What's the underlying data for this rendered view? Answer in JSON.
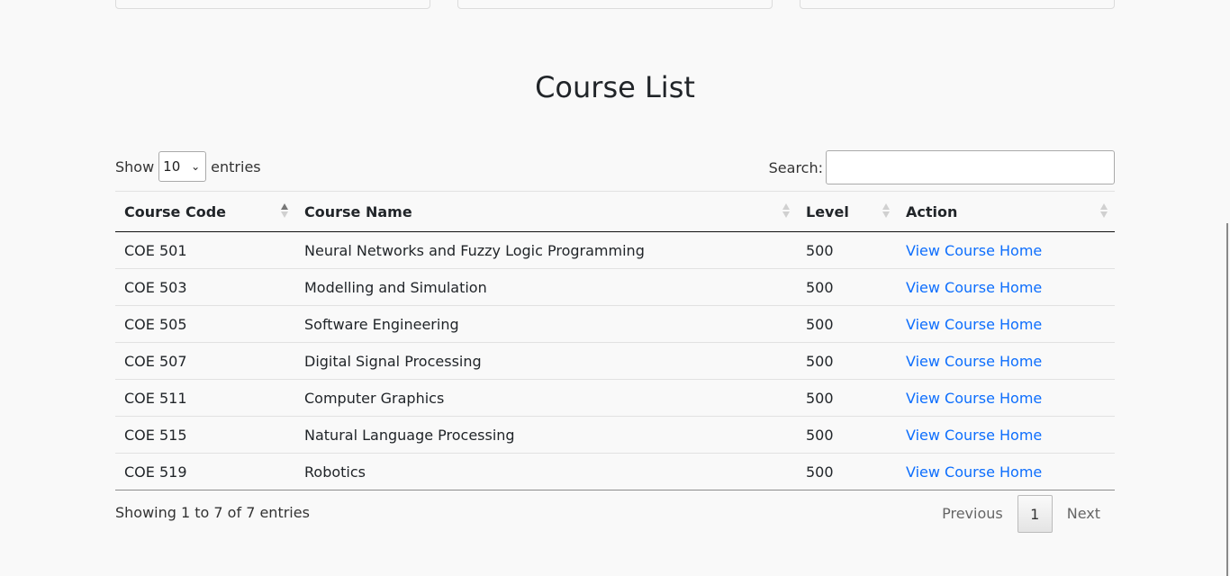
{
  "page": {
    "title": "Course List"
  },
  "controls": {
    "show_label": "Show",
    "page_length": "10",
    "entries_label": "entries",
    "search_label": "Search:",
    "search_value": ""
  },
  "table": {
    "headers": [
      "Course Code",
      "Course Name",
      "Level",
      "Action"
    ],
    "rows": [
      {
        "code": "COE 501",
        "name": "Neural Networks and Fuzzy Logic Programming",
        "level": "500",
        "action": "View Course Home"
      },
      {
        "code": "COE 503",
        "name": "Modelling and Simulation",
        "level": "500",
        "action": "View Course Home"
      },
      {
        "code": "COE 505",
        "name": "Software Engineering",
        "level": "500",
        "action": "View Course Home"
      },
      {
        "code": "COE 507",
        "name": "Digital Signal Processing",
        "level": "500",
        "action": "View Course Home"
      },
      {
        "code": "COE 511",
        "name": "Computer Graphics",
        "level": "500",
        "action": "View Course Home"
      },
      {
        "code": "COE 515",
        "name": "Natural Language Processing",
        "level": "500",
        "action": "View Course Home"
      },
      {
        "code": "COE 519",
        "name": "Robotics",
        "level": "500",
        "action": "View Course Home"
      }
    ]
  },
  "footer": {
    "info": "Showing 1 to 7 of 7 entries",
    "previous": "Previous",
    "current_page": "1",
    "next": "Next"
  },
  "colors": {
    "link": "#0d6efd",
    "background": "#f9f9f9"
  }
}
